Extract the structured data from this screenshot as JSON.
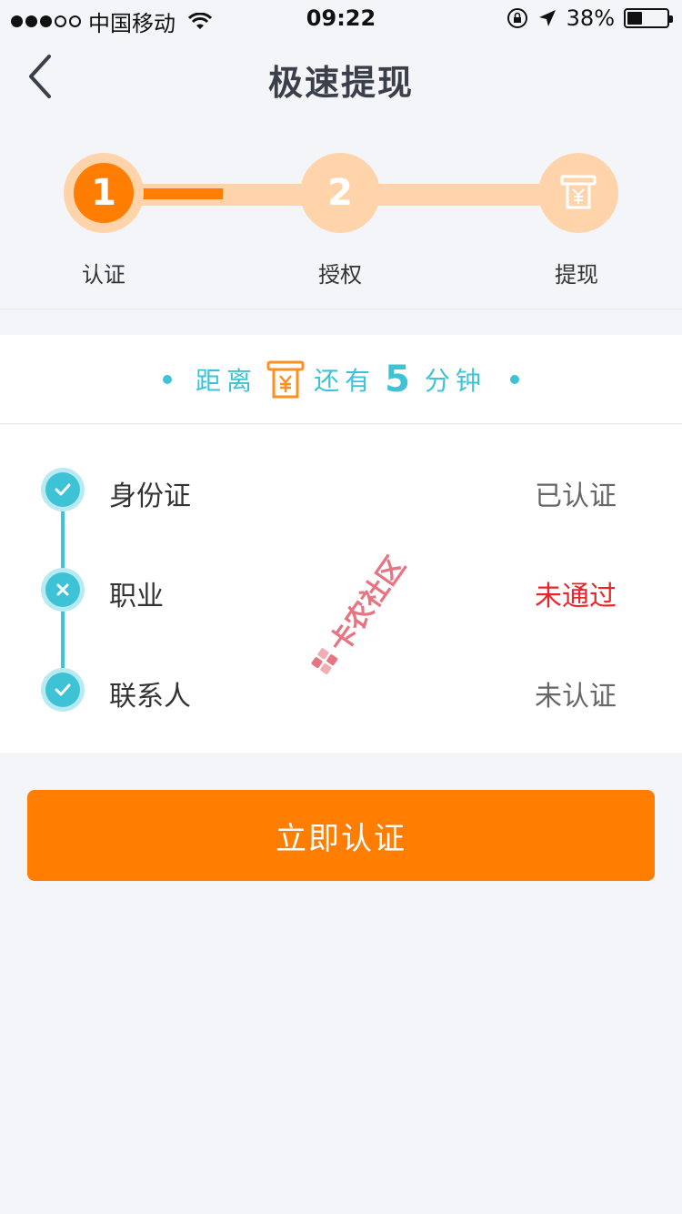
{
  "status_bar": {
    "carrier": "中国移动",
    "time": "09:22",
    "battery_text": "38%",
    "battery_level": 0.38,
    "signal_bars_filled": 3,
    "signal_bars_total": 5
  },
  "nav": {
    "title": "极速提现",
    "back_icon": "chevron-left-icon"
  },
  "steps": {
    "progress": 0.25,
    "items": [
      {
        "number": "1",
        "label": "认证",
        "active": true
      },
      {
        "number": "2",
        "label": "授权",
        "active": false
      },
      {
        "icon": "atm-icon",
        "label": "提现",
        "active": false
      }
    ]
  },
  "banner": {
    "prefix": "距离",
    "icon": "atm-yen-icon",
    "middle": "还有",
    "number": "5",
    "suffix": "分钟"
  },
  "verification": {
    "items": [
      {
        "label": "身份证",
        "status": "已认证",
        "icon": "check-icon"
      },
      {
        "label": "职业",
        "status": "未通过",
        "icon": "cross-icon"
      },
      {
        "label": "联系人",
        "status": "未认证",
        "icon": "check-icon"
      }
    ]
  },
  "watermark": {
    "text": "卡农社区"
  },
  "action": {
    "label": "立即认证"
  },
  "colors": {
    "accent": "#ff7d00",
    "accent_light": "#ffd4ab",
    "teal": "#3ec3d6",
    "failed": "#e8252a"
  }
}
